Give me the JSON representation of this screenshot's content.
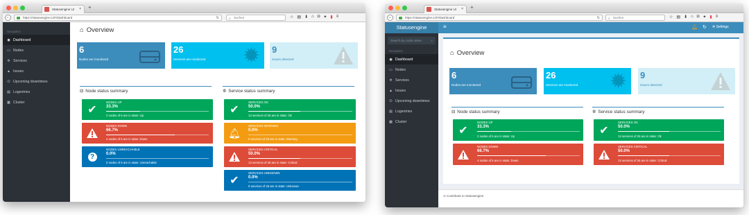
{
  "browser": {
    "tab_title": "Statusengine UI",
    "tab_close": "×",
    "new_tab": "+",
    "url_host": "https://statusengine.io",
    "url_path": "/#!/dashboard",
    "search_placeholder": "Suchen"
  },
  "left": {
    "sidebar": {
      "caption": "Navigation",
      "items": [
        {
          "label": "Dashboard",
          "icon": "dashboard-icon"
        },
        {
          "label": "Nodes",
          "icon": "desktop-icon"
        },
        {
          "label": "Services",
          "icon": "cogs-icon"
        },
        {
          "label": "Issues",
          "icon": "warning-icon"
        },
        {
          "label": "Upcoming downtimes",
          "icon": "power-off-icon"
        },
        {
          "label": "Logentries",
          "icon": "database-icon"
        },
        {
          "label": "Cluster",
          "icon": "server-icon"
        }
      ]
    },
    "page_title": "Overview",
    "boxes": [
      {
        "number": "6",
        "label": "Nodes are monitored",
        "color": "#3c8dbc"
      },
      {
        "number": "26",
        "label": "Services are monitored",
        "color": "#00c0ef"
      },
      {
        "number": "9",
        "label": "Issues detected",
        "color": "#d2eff7"
      }
    ],
    "node_summary": {
      "title": "Node status summary",
      "cards": [
        {
          "title": "NODES UP",
          "pct": "33.3%",
          "progress": 33.3,
          "desc": "2 nodes of 6 are in state: Up",
          "color": "green"
        },
        {
          "title": "NODES DOWN",
          "pct": "66.7%",
          "progress": 66.7,
          "desc": "4 nodes of 6 are in state: Down",
          "color": "red"
        },
        {
          "title": "NODES UNREACHABLE",
          "pct": "0.0%",
          "progress": 0,
          "desc": "0 nodes of 6 are in state: Unreachable",
          "color": "blue"
        }
      ]
    },
    "service_summary": {
      "title": "Service status summary",
      "cards": [
        {
          "title": "SERVICES OK",
          "pct": "50.0%",
          "progress": 50,
          "desc": "13 services of 26 are in state: Ok",
          "color": "green"
        },
        {
          "title": "SERVICES WARNING",
          "pct": "0.0%",
          "progress": 0,
          "desc": "0 services of 26 are in state: Warning",
          "color": "orange"
        },
        {
          "title": "SERVICES CRITICAL",
          "pct": "50.0%",
          "progress": 50,
          "desc": "13 services of 26 are in state: Critical",
          "color": "red"
        },
        {
          "title": "SERVICES UNKNOWN",
          "pct": "0.0%",
          "progress": 0,
          "desc": "0 services of 26 are in state: Unknown",
          "color": "blue"
        }
      ]
    }
  },
  "right": {
    "brand": "Statusengine",
    "menu_icon": "≡",
    "settings_label": "Settings",
    "search_placeholder": "Search by node name",
    "sidebar": {
      "caption": "Navigation",
      "items": [
        {
          "label": "Dashboard"
        },
        {
          "label": "Nodes"
        },
        {
          "label": "Services"
        },
        {
          "label": "Issues"
        },
        {
          "label": "Upcoming downtimes"
        },
        {
          "label": "Logentries"
        },
        {
          "label": "Cluster"
        }
      ]
    },
    "page_title": "Overview",
    "boxes": [
      {
        "number": "6",
        "label": "Nodes are monitored"
      },
      {
        "number": "26",
        "label": "Services are monitored"
      },
      {
        "number": "9",
        "label": "Issues detected"
      }
    ],
    "node_summary": {
      "title": "Node status summary",
      "cards": [
        {
          "title": "NODES UP",
          "pct": "33.3%",
          "progress": 33.3,
          "desc": "2 nodes of 6 are in state: Up"
        },
        {
          "title": "NODES DOWN",
          "pct": "66.7%",
          "progress": 66.7,
          "desc": "4 nodes of 6 are in state: Down"
        }
      ]
    },
    "service_summary": {
      "title": "Service status summary",
      "cards": [
        {
          "title": "SERVICES OK",
          "pct": "50.0%",
          "progress": 50,
          "desc": "13 services of 26 are in state: Ok"
        },
        {
          "title": "SERVICES CRITICAL",
          "pct": "50.0%",
          "progress": 50,
          "desc": "13 services of 26 are in state: Critical"
        }
      ]
    },
    "footer": "Contribute to Statusengine"
  }
}
